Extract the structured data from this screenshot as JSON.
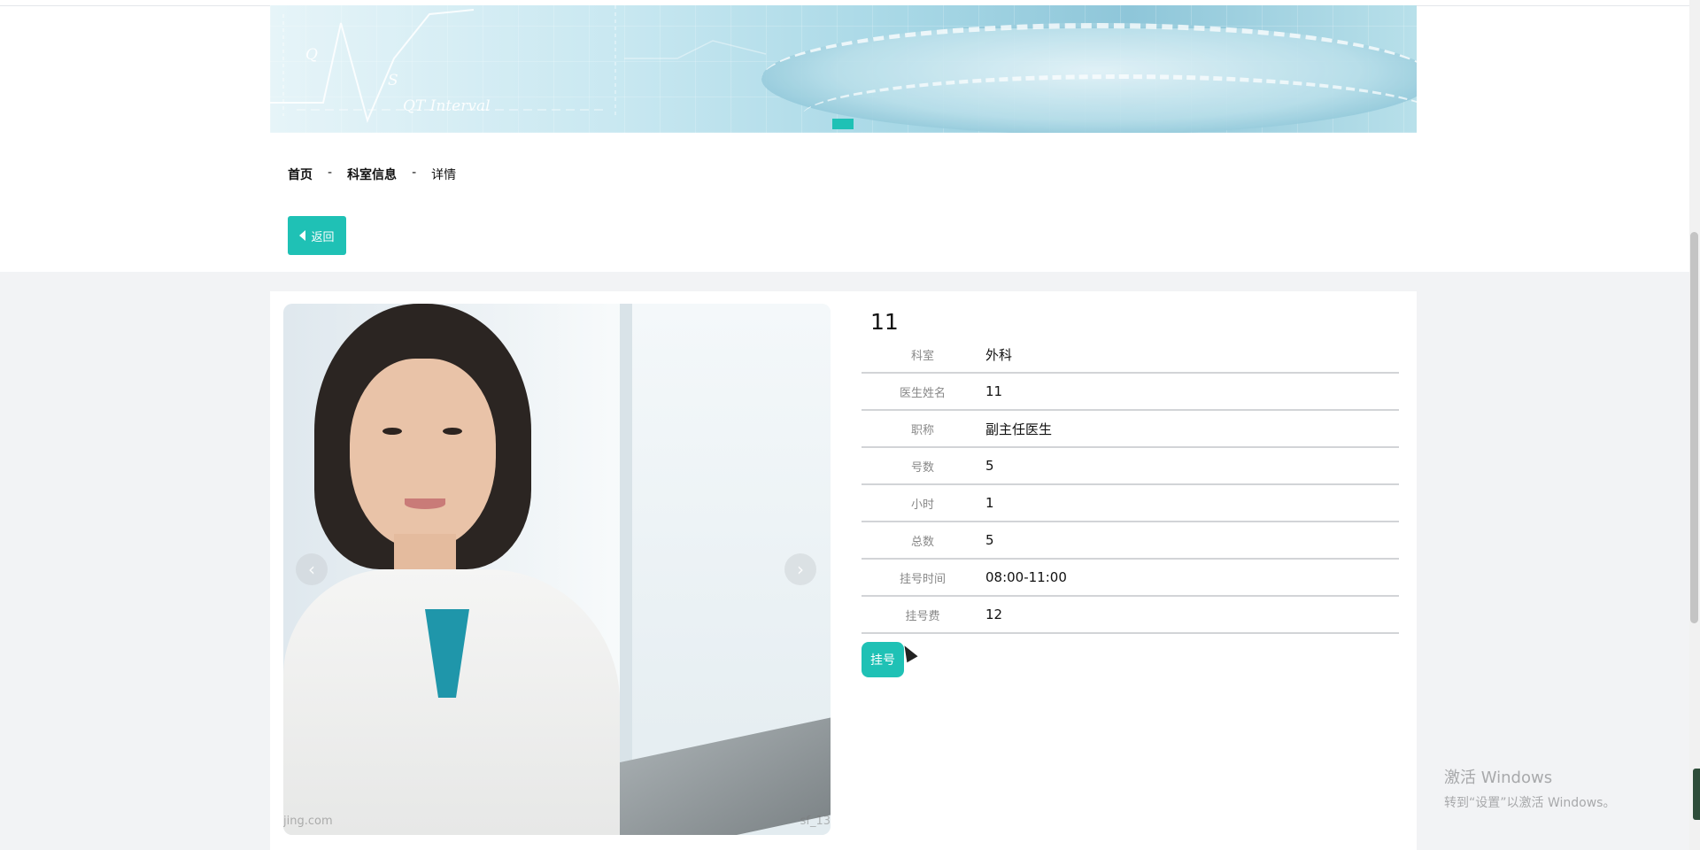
{
  "banner": {
    "labels": [
      "Q",
      "S",
      "QT Interval"
    ],
    "active_slide_color": "#1fc1b5"
  },
  "breadcrumb": {
    "home": "首页",
    "section": "科室信息",
    "current": "详情",
    "separator": "-"
  },
  "back_button": {
    "label": "返回",
    "icon": "caret-left-icon"
  },
  "photo": {
    "watermark_left": "jing.com",
    "watermark_right": "sf_13",
    "prev_icon": "‹",
    "next_icon": "›"
  },
  "detail": {
    "title": "11",
    "rows": [
      {
        "label": "科室",
        "value": "外科"
      },
      {
        "label": "医生姓名",
        "value": "11"
      },
      {
        "label": "职称",
        "value": "副主任医生"
      },
      {
        "label": "号数",
        "value": "5"
      },
      {
        "label": "小时",
        "value": "1"
      },
      {
        "label": "总数",
        "value": "5"
      },
      {
        "label": "挂号时间",
        "value": "08:00-11:00"
      },
      {
        "label": "挂号费",
        "value": "12"
      }
    ],
    "register_button": "挂号"
  },
  "windows_activation": {
    "line1": "激活 Windows",
    "line2": "转到“设置”以激活 Windows。"
  },
  "colors": {
    "accent": "#1fc1b5",
    "page_background": "#f2f3f5"
  }
}
